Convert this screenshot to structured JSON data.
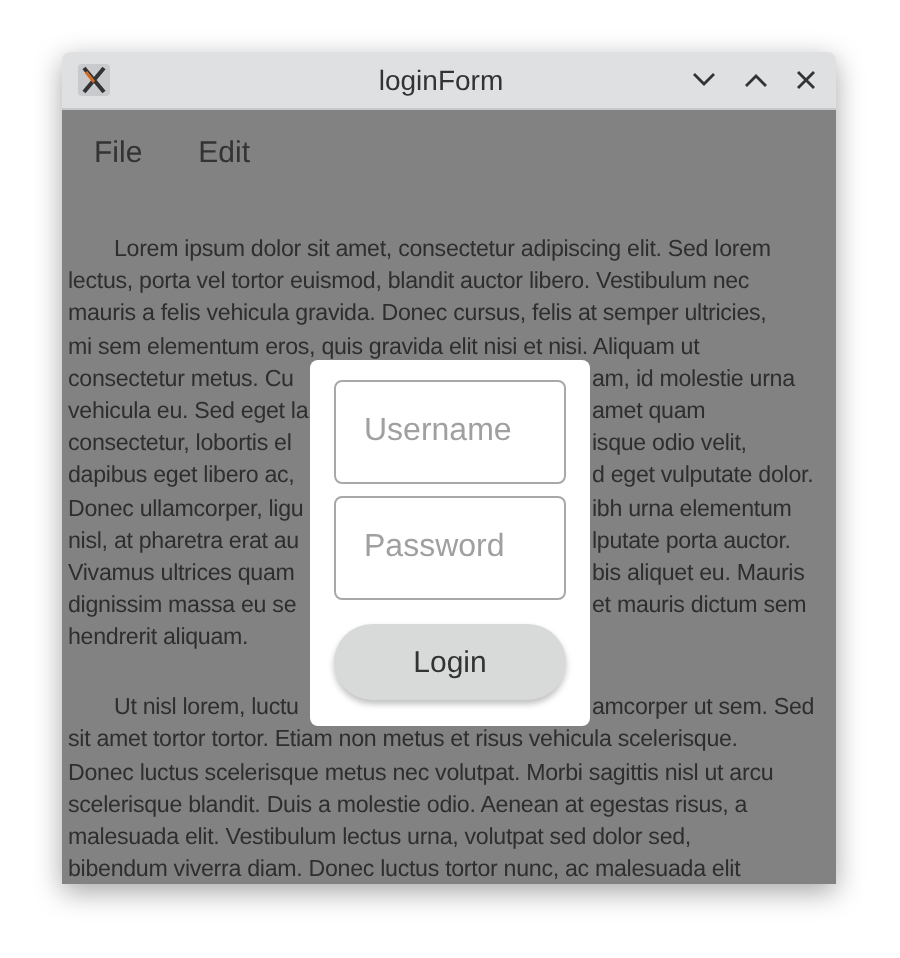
{
  "window": {
    "title": "loginForm"
  },
  "menu": [
    {
      "label": "File"
    },
    {
      "label": "Edit"
    }
  ],
  "document": {
    "paragraphs": [
      {
        "lines": [
          {
            "left": "Lorem ipsum dolor sit amet, consectetur adipiscing elit. Sed lorem"
          },
          {
            "left": "lectus, porta vel tortor euismod, blandit auctor libero. Vestibulum nec"
          },
          {
            "left": "mauris a felis vehicula gravida. Donec cursus, felis at semper ultricies,"
          },
          {
            "left": "mi sem elementum eros, quis gravida elit nisi et nisi. Aliquam ut"
          },
          {
            "left": "consectetur metus. Cu",
            "right": "am, id molestie urna"
          },
          {
            "left": "vehicula eu. Sed eget la",
            "right": "amet quam"
          },
          {
            "left": "consectetur, lobortis el",
            "right": "isque odio velit,"
          },
          {
            "left": "dapibus eget libero ac,",
            "right": "d eget vulputate dolor."
          },
          {
            "left": "Donec ullamcorper, ligu",
            "right": "ibh urna elementum"
          },
          {
            "left": "nisl, at pharetra erat au",
            "right": "lputate porta auctor."
          },
          {
            "left": "Vivamus ultrices quam",
            "right": "bis aliquet eu. Mauris"
          },
          {
            "left": "dignissim massa eu se",
            "right": "et mauris dictum sem"
          },
          {
            "left": "hendrerit aliquam."
          }
        ]
      },
      {
        "lines": [
          {
            "left": "Ut nisl lorem, luctu",
            "right": "amcorper ut sem. Sed"
          },
          {
            "left": "sit amet tortor tortor. Etiam non metus et risus vehicula scelerisque."
          },
          {
            "left": "Donec luctus scelerisque metus nec volutpat. Morbi sagittis nisl ut arcu"
          },
          {
            "left": "scelerisque blandit. Duis a molestie odio. Aenean at egestas risus, a"
          },
          {
            "left": "malesuada elit. Vestibulum lectus urna, volutpat sed dolor sed,"
          },
          {
            "left": "bibendum viverra diam. Donec luctus tortor nunc, ac malesuada elit"
          }
        ]
      }
    ]
  },
  "dialog": {
    "username": {
      "placeholder": "Username"
    },
    "password": {
      "placeholder": "Password"
    },
    "button": "Login"
  }
}
